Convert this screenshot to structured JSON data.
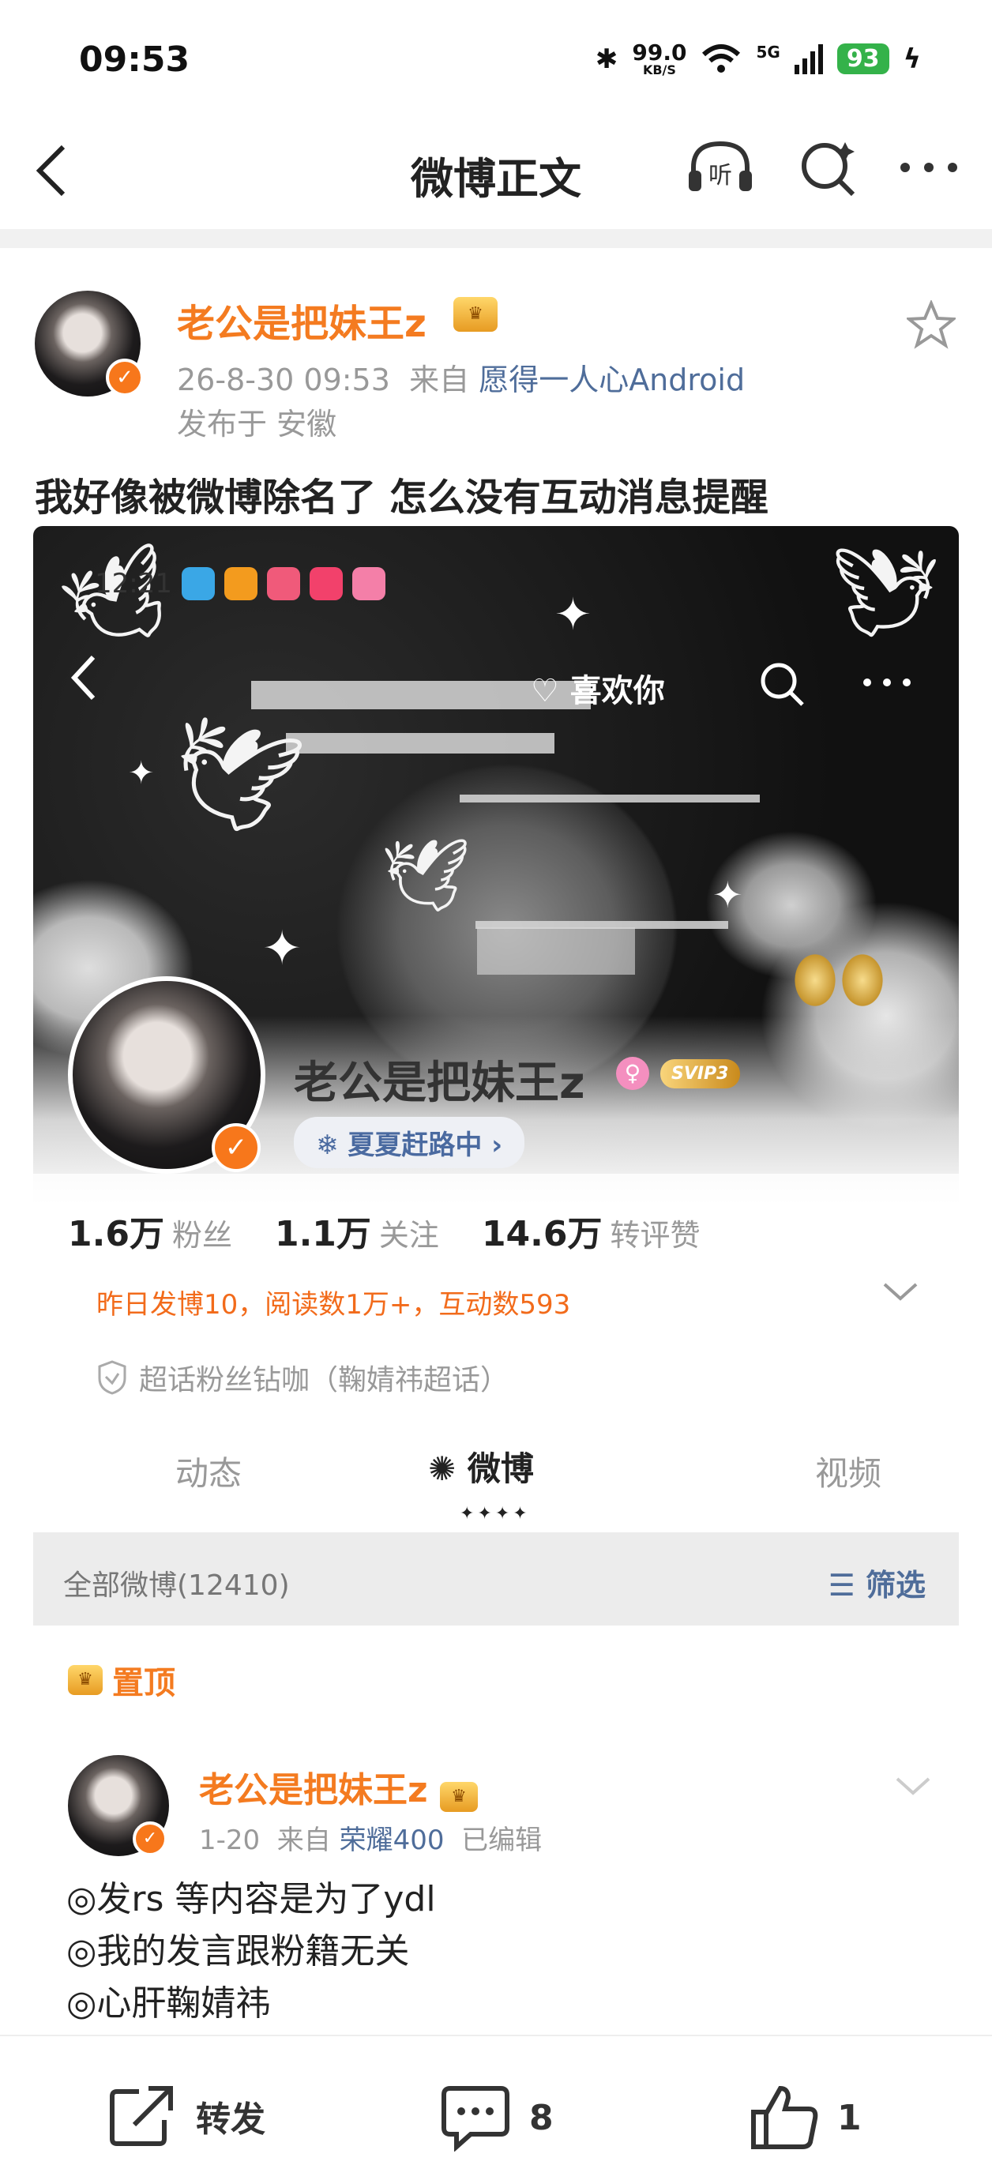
{
  "status_bar": {
    "time": "09:53",
    "net_speed": "99.0",
    "net_unit": "KB/S",
    "signal": "5G",
    "battery": "93"
  },
  "nav": {
    "title": "微博正文"
  },
  "post": {
    "author": "老公是把妹王z",
    "time": "26-8-30 09:53",
    "source_prefix": "来自",
    "source": "愿得一人心Android",
    "location": "发布于 安徽",
    "text": "我好像被微博除名了 怎么没有互动消息提醒"
  },
  "screenshot": {
    "inner_time": "12:21",
    "like_you": "喜欢你",
    "profile_name": "老公是把妹王z",
    "svip": "SVIP3",
    "topic": "夏夏赶路中 ›",
    "stats": [
      {
        "value": "1.6万",
        "label": "粉丝"
      },
      {
        "value": "1.1万",
        "label": "关注"
      },
      {
        "value": "14.6万",
        "label": "转评赞"
      }
    ],
    "yesterday": "昨日发博10，阅读数1万+，互动数593",
    "superfan": "超话粉丝钻咖（鞠婧祎超话）",
    "tabs": [
      "动态",
      "微博",
      "视频"
    ],
    "active_tab_marks": "✦✦✦✦",
    "filter_label": "全部微博(12410)",
    "filter_button": "筛选",
    "pinned": "置顶",
    "inner_post": {
      "author": "老公是把妹王z",
      "time": "1-20",
      "source_prefix": "来自",
      "source": "荣耀400",
      "edited": "已编辑",
      "lines": [
        "◎发rs 等内容是为了ydl",
        "◎我的发言跟粉籍无关",
        "◎心肝鞠婧祎"
      ]
    }
  },
  "bottom_bar": {
    "repost": "转发",
    "comments": "8",
    "likes": "1"
  },
  "colors": {
    "accent": "#f47b20",
    "link": "#4f6d9a",
    "battery": "#34b24a"
  }
}
